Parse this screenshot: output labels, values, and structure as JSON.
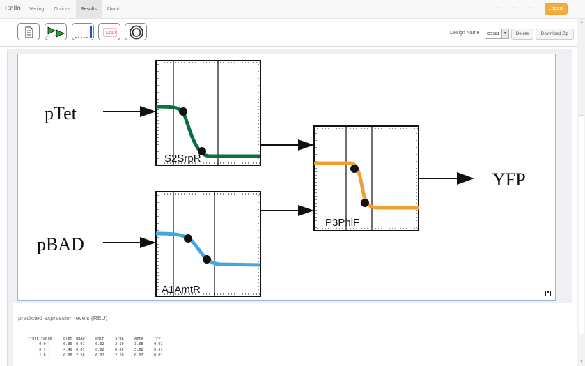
{
  "app": {
    "brand": "Cello",
    "tabs": [
      {
        "label": "Verilog",
        "active": false
      },
      {
        "label": "Options",
        "active": false
      },
      {
        "label": "Results",
        "active": true
      },
      {
        "label": "About",
        "active": false
      }
    ],
    "logout_label": "Logout"
  },
  "toolbar": {
    "buttons": [
      {
        "name": "document-icon"
      },
      {
        "name": "circuit-icon"
      },
      {
        "name": "plot-icon"
      },
      {
        "name": "dna-icon"
      },
      {
        "name": "target-icon"
      }
    ],
    "design_name_label": "Design Name",
    "design_name_value": "essai",
    "delete_label": "Delete",
    "download_zip_label": "Download Zip"
  },
  "circuit": {
    "inputs": [
      "pTet",
      "pBAD"
    ],
    "output": "YFP",
    "gates": [
      {
        "label": "S2SrpR",
        "color": "#0a7040"
      },
      {
        "label": "A1AmtR",
        "color": "#40a8dd"
      },
      {
        "label": "P3PhlF",
        "color": "#f0a030"
      }
    ]
  },
  "expression": {
    "title": "predicted expression levels (REU)",
    "header": [
      "truth table",
      "pTet",
      "pBAD",
      "PhlF",
      "SrpR",
      "AmtR",
      "YFP"
    ],
    "rows": [
      [
        "[ 0 0 ]",
        "0.00",
        "0.01",
        "0.02",
        "2.10",
        "3.68",
        "0.01"
      ],
      [
        "[ 0 1 ]",
        "4.40",
        "0.01",
        "0.02",
        "0.00",
        "3.68",
        "0.01"
      ],
      [
        "[ 1 0 ]",
        "0.00",
        "2.50",
        "0.02",
        "2.10",
        "0.07",
        "0.01"
      ]
    ]
  }
}
